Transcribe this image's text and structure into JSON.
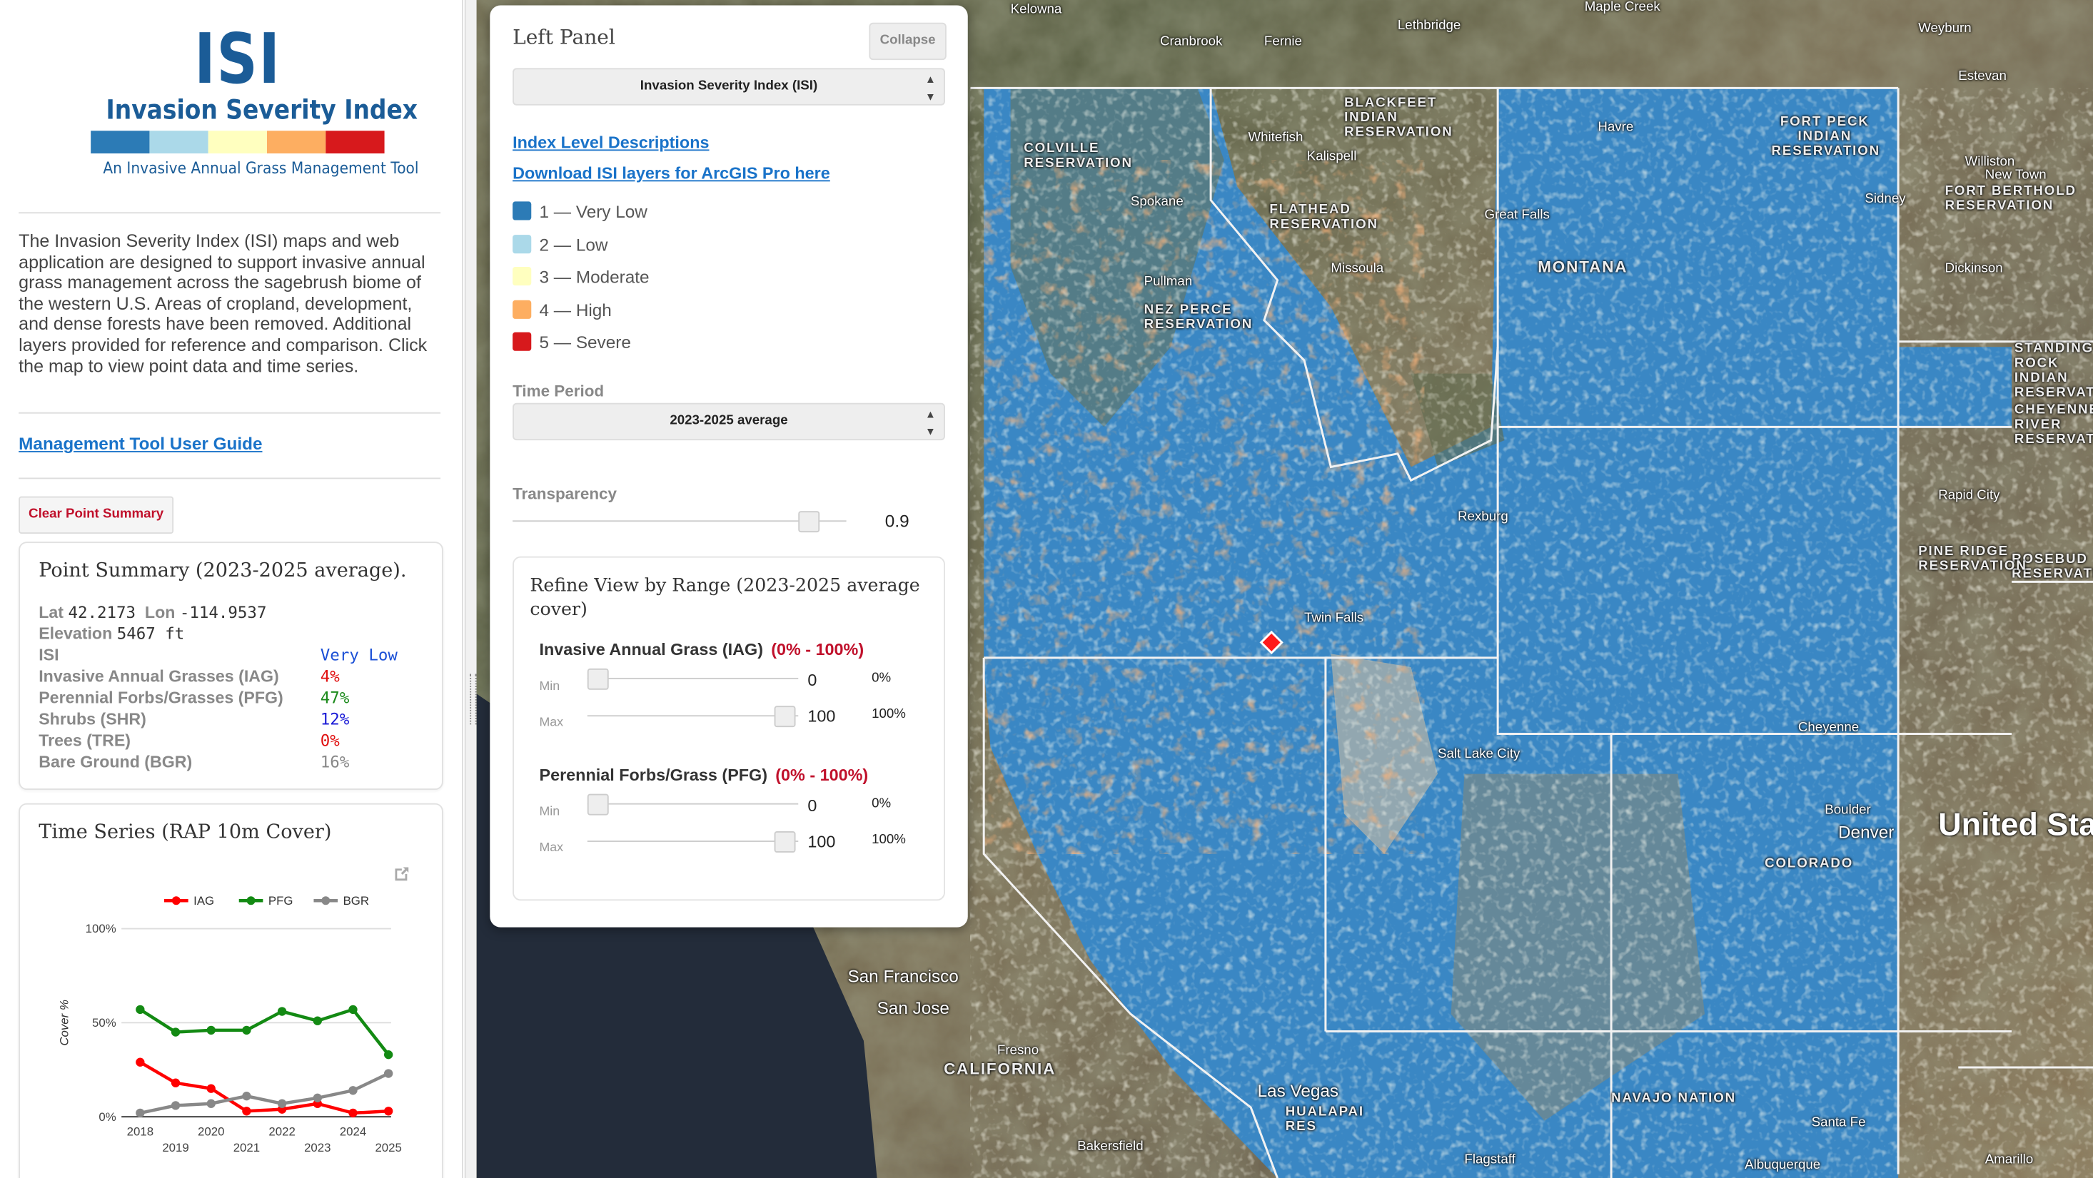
{
  "sidebar": {
    "logo": {
      "title": "ISI",
      "subtitle": "Invasion Severity Index",
      "bar_colors": [
        "#2c7bb6",
        "#abd9e9",
        "#ffffbf",
        "#fdae61",
        "#d7191c"
      ],
      "tagline": "An Invasive Annual Grass Management Tool"
    },
    "description": "The Invasion Severity Index (ISI) maps and web application are designed to support invasive annual grass management across the sagebrush biome of the western U.S. Areas of cropland, development, and dense forests have been removed. Additional layers provided for reference and comparison. Click the map to view point data and time series.",
    "guide_link": "Management Tool User Guide",
    "clear_button": "Clear Point Summary",
    "point_summary": {
      "title": "Point Summary (2023-2025 average).",
      "lat_label": "Lat",
      "lat": "42.2173",
      "lon_label": "Lon",
      "lon": "-114.9537",
      "elev_label": "Elevation",
      "elev": "5467 ft",
      "rows": [
        {
          "label": "ISI",
          "value": "Very Low",
          "color": "#1a4fd6"
        },
        {
          "label": "Invasive Annual Grasses (IAG)",
          "value": "4%",
          "color": "#e01010"
        },
        {
          "label": "Perennial Forbs/Grasses (PFG)",
          "value": "47%",
          "color": "#1b8a1b"
        },
        {
          "label": "Shrubs (SHR)",
          "value": "12%",
          "color": "#1a1ad6"
        },
        {
          "label": "Trees (TRE)",
          "value": "0%",
          "color": "#e01010"
        },
        {
          "label": "Bare Ground (BGR)",
          "value": "16%",
          "color": "#888888"
        }
      ]
    },
    "time_series": {
      "title": "Time Series (RAP 10m Cover)"
    }
  },
  "chart_data": {
    "type": "line",
    "x": [
      2018,
      2019,
      2020,
      2021,
      2022,
      2023,
      2024,
      2025
    ],
    "x_ticks_top": [
      "2018",
      "2020",
      "2022",
      "2024"
    ],
    "x_ticks_bottom": [
      "2019",
      "2021",
      "2023",
      "2025"
    ],
    "ylabel": "Cover %",
    "ylim": [
      0,
      100
    ],
    "y_ticks": [
      "0%",
      "50%",
      "100%"
    ],
    "legend_position": "top",
    "series": [
      {
        "name": "IAG",
        "color": "#ff0000",
        "values": [
          29,
          18,
          15,
          3,
          4,
          7,
          2,
          3
        ]
      },
      {
        "name": "PFG",
        "color": "#138a13",
        "values": [
          57,
          45,
          46,
          46,
          56,
          51,
          57,
          33
        ]
      },
      {
        "name": "BGR",
        "color": "#888888",
        "values": [
          2,
          6,
          7,
          11,
          7,
          10,
          14,
          23
        ]
      }
    ]
  },
  "panel": {
    "title": "Left Panel",
    "collapse": "Collapse",
    "layer_select": "Invasion Severity Index (ISI)",
    "link_descriptions": "Index Level Descriptions",
    "link_download": "Download ISI layers for ArcGIS Pro here",
    "legend": [
      {
        "label": "1 — Very Low",
        "color": "#2c7bb6"
      },
      {
        "label": "2 — Low",
        "color": "#abd9e9"
      },
      {
        "label": "3 — Moderate",
        "color": "#ffffbf"
      },
      {
        "label": "4 — High",
        "color": "#fdae61"
      },
      {
        "label": "5 — Severe",
        "color": "#d7191c"
      }
    ],
    "time_label": "Time Period",
    "time_select": "2023-2025 average",
    "transparency_label": "Transparency",
    "transparency": "0.9",
    "transparency_fraction": 0.9,
    "refine": {
      "title": "Refine View by Range (2023-2025 average cover)",
      "min_label": "Min",
      "max_label": "Max",
      "sections": [
        {
          "name": "Invasive Annual Grass (IAG)",
          "range": "(0% - 100%)",
          "min": "0",
          "min_pct": "0%",
          "max": "100",
          "max_pct": "100%"
        },
        {
          "name": "Perennial Forbs/Grass (PFG)",
          "range": "(0% - 100%)",
          "min": "0",
          "min_pct": "0%",
          "max": "100",
          "max_pct": "100%"
        }
      ]
    }
  },
  "map": {
    "labels": {
      "kelowna": "Kelowna",
      "lethbridge": "Lethbridge",
      "cranbrook": "Cranbrook",
      "fernie": "Fernie",
      "maple_creek": "Maple Creek",
      "weyburn": "Weyburn",
      "estevan": "Estevan",
      "blackfeet": "BLACKFEET INDIAN RESERVATION",
      "colville": "COLVILLE RESERVATION",
      "whitefish": "Whitefish",
      "kalispell": "Kalispell",
      "havre": "Havre",
      "fort_peck": "FORT PECK INDIAN RESERVATION",
      "williston": "Williston",
      "new_town": "New Town",
      "fort_berthold": "FORT BERTHOLD RESERVATION",
      "spokane": "Spokane",
      "flathead": "FLATHEAD RESERVATION",
      "great_falls": "Great Falls",
      "montana": "MONTANA",
      "missoula": "Missoula",
      "sidney": "Sidney",
      "dickinson": "Dickinson",
      "pullman": "Pullman",
      "nez_perce": "NEZ PERCE RESERVATION",
      "standing_rock": "STANDING ROCK INDIAN RESERVATION",
      "cheyenne_river": "CHEYENNE RIVER RESERVATION",
      "rexburg": "Rexburg",
      "twin_falls": "Twin Falls",
      "rapid_city": "Rapid City",
      "rosebud": "ROSEBUD RESERVATION",
      "pine_ridge": "PINE RIDGE RESERVATION",
      "cheyenne": "Cheyenne",
      "salt_lake": "Salt Lake City",
      "boulder": "Boulder",
      "denver": "Denver",
      "united_states": "United States",
      "colorado": "COLORADO",
      "san_francisco": "San Francisco",
      "san_jose": "San Jose",
      "fresno": "Fresno",
      "california": "CALIFORNIA",
      "las_vegas": "Las Vegas",
      "bakersfield": "Bakersfield",
      "flagstaff": "Flagstaff",
      "albuquerque": "Albuquerque",
      "amarillo": "Amarillo",
      "santa_fe": "Santa Fe",
      "navajo": "NAVAJO NATION",
      "hualapai": "HUALAPAI RES"
    }
  }
}
